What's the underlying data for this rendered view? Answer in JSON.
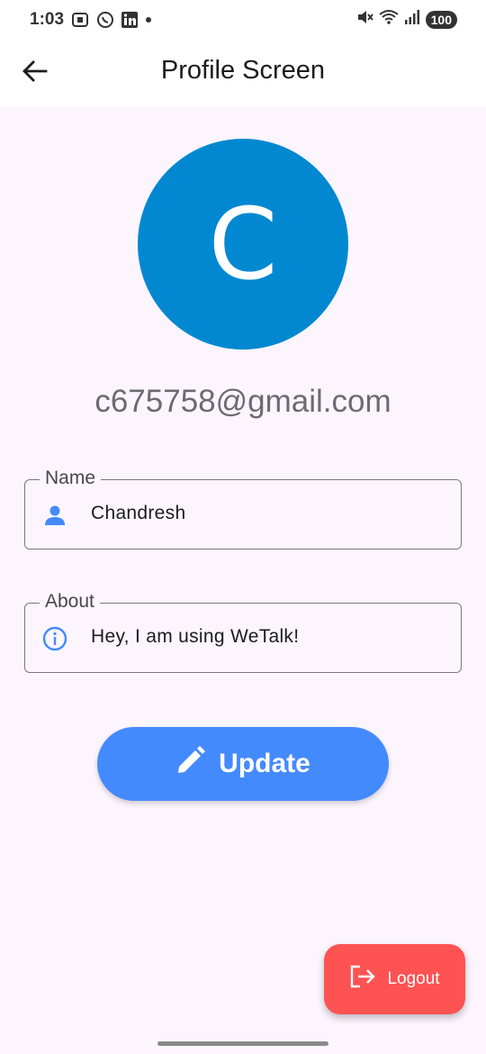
{
  "status_bar": {
    "time": "1:03",
    "battery": "100",
    "icons": [
      "screenshot-icon",
      "whatsapp-icon",
      "linkedin-icon",
      "dot-icon",
      "mute-icon",
      "wifi-icon",
      "signal-icon"
    ]
  },
  "app_bar": {
    "title": "Profile Screen",
    "back_icon": "arrow-back-icon"
  },
  "profile": {
    "avatar_letter": "C",
    "avatar_color": "#0288d1",
    "email": "c675758@gmail.com"
  },
  "fields": {
    "name": {
      "label": "Name",
      "value": "Chandresh",
      "icon": "person-icon"
    },
    "about": {
      "label": "About",
      "value": "Hey, I am using WeTalk!",
      "icon": "info-icon"
    }
  },
  "update_button": {
    "label": "Update",
    "icon": "edit-icon",
    "color": "#448aff"
  },
  "logout_button": {
    "label": "Logout",
    "icon": "logout-icon",
    "color": "#ff5252"
  }
}
